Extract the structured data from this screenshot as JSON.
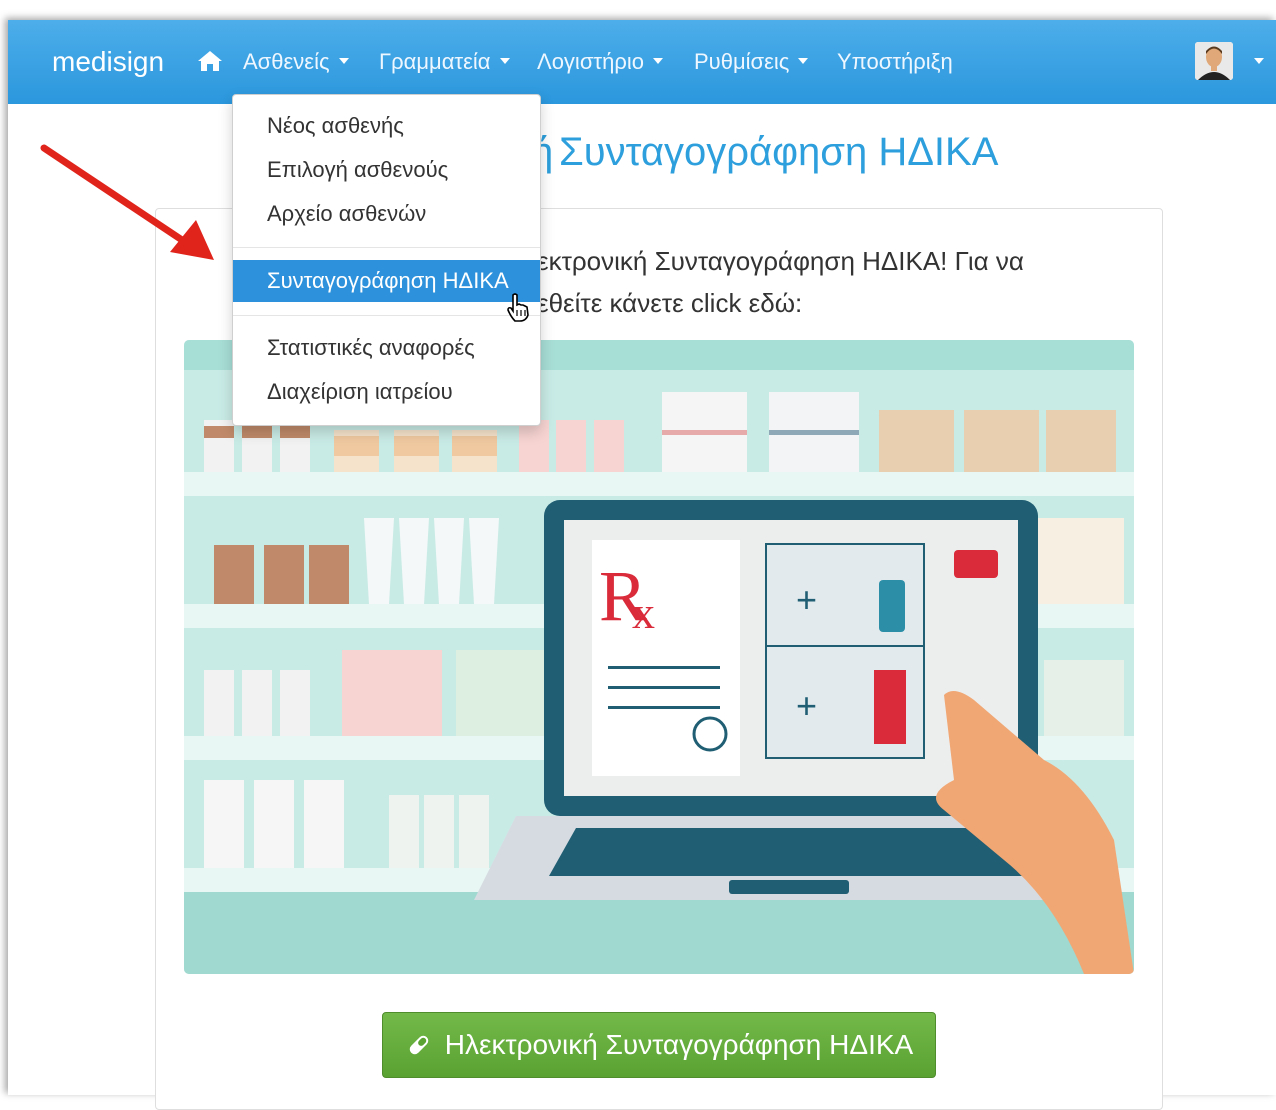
{
  "navbar": {
    "brand": "medisign",
    "items": [
      {
        "label": "Ασθενείς",
        "dropdown": true
      },
      {
        "label": "Γραμματεία",
        "dropdown": true
      },
      {
        "label": "Λογιστήριο",
        "dropdown": true
      },
      {
        "label": "Ρυθμίσεις",
        "dropdown": true
      },
      {
        "label": "Υποστήριξη",
        "dropdown": false
      }
    ]
  },
  "page": {
    "title_prefix": "ή",
    "title": "Συνταγογράφηση ΗΔΙΚΑ",
    "intro_line1": "εκτρονική Συνταγογράφηση ΗΔΙΚΑ! Για να",
    "intro_line2": "εθείτε κάνετε click εδώ:",
    "button_label": "Ηλεκτρονική Συνταγογράφηση ΗΔΙΚΑ"
  },
  "dropdown": {
    "items": [
      {
        "label": "Νέος ασθενής"
      },
      {
        "label": "Επιλογή ασθενούς"
      },
      {
        "label": "Αρχείο ασθενών"
      },
      {
        "label": "Συνταγογράφηση ΗΔΙΚΑ",
        "active": true
      },
      {
        "label": "Στατιστικές αναφορές"
      },
      {
        "label": "Διαχείριση ιατρείου"
      }
    ]
  },
  "colors": {
    "navbar": "#3aa5e6",
    "accent": "#2d92db",
    "title": "#2d9fdc",
    "button": "#65ad3d",
    "arrow": "#e0241b"
  }
}
